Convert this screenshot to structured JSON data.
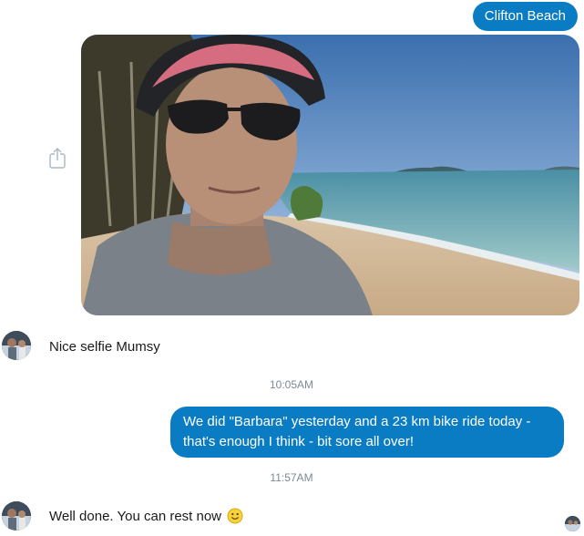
{
  "messages": {
    "sent_location": "Clifton Beach",
    "received_1": "Nice selfie Mumsy",
    "timestamp_1": "10:05AM",
    "sent_text": "We did \"Barbara\" yesterday and a 23 km bike ride today - that's enough I think - bit sore all over!",
    "timestamp_2": "11:57AM",
    "received_2": "Well done. You can rest now"
  },
  "icons": {
    "share": "share-icon",
    "emoji": "smiley-emoji-icon"
  },
  "colors": {
    "outgoing_bubble": "#0a7cc4",
    "outgoing_text": "#ffffff",
    "timestamp": "#7b8a96",
    "incoming_text": "#1a1a1a"
  }
}
